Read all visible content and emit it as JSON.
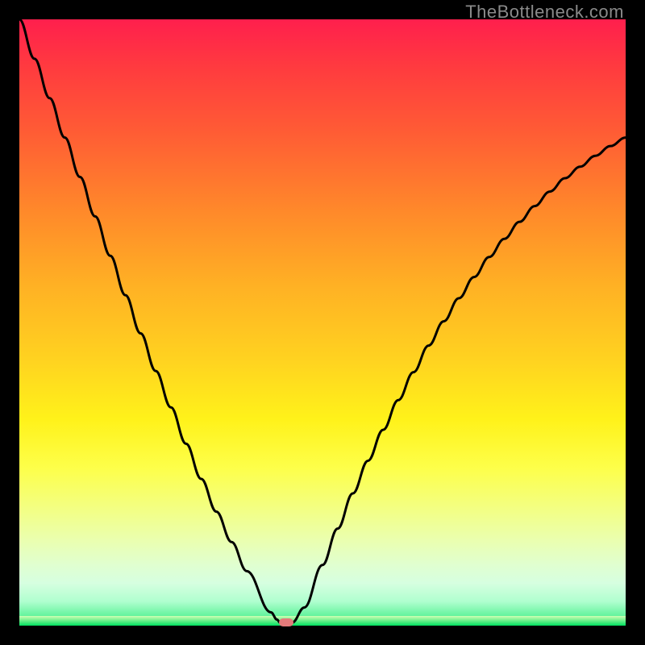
{
  "watermark": "TheBottleneck.com",
  "layout": {
    "image_size": 800,
    "plot_inset": 24,
    "plot_size": 752
  },
  "chart_data": {
    "type": "line",
    "title": "",
    "xlabel": "",
    "ylabel": "",
    "xlim": [
      0,
      1
    ],
    "ylim": [
      0,
      1
    ],
    "x": [
      0.0,
      0.025,
      0.05,
      0.075,
      0.1,
      0.125,
      0.15,
      0.175,
      0.2,
      0.225,
      0.25,
      0.275,
      0.3,
      0.325,
      0.35,
      0.375,
      0.415,
      0.425,
      0.43,
      0.44,
      0.45,
      0.47,
      0.5,
      0.525,
      0.55,
      0.575,
      0.6,
      0.625,
      0.65,
      0.675,
      0.7,
      0.725,
      0.75,
      0.775,
      0.8,
      0.825,
      0.85,
      0.875,
      0.9,
      0.925,
      0.95,
      0.975,
      1.0
    ],
    "values": [
      1.0,
      0.935,
      0.87,
      0.805,
      0.74,
      0.675,
      0.61,
      0.545,
      0.482,
      0.42,
      0.36,
      0.3,
      0.242,
      0.188,
      0.138,
      0.09,
      0.022,
      0.01,
      0.005,
      0.005,
      0.005,
      0.03,
      0.1,
      0.16,
      0.218,
      0.272,
      0.323,
      0.372,
      0.418,
      0.462,
      0.502,
      0.54,
      0.575,
      0.608,
      0.638,
      0.666,
      0.692,
      0.716,
      0.738,
      0.757,
      0.775,
      0.791,
      0.805
    ],
    "marker": {
      "x": 0.44,
      "y": 0.005
    },
    "gradient_bg": [
      "#ff1f4d",
      "#ffd220",
      "#fff21a",
      "#00e060"
    ],
    "line_color": "#000000",
    "marker_color": "#e47a7a"
  }
}
